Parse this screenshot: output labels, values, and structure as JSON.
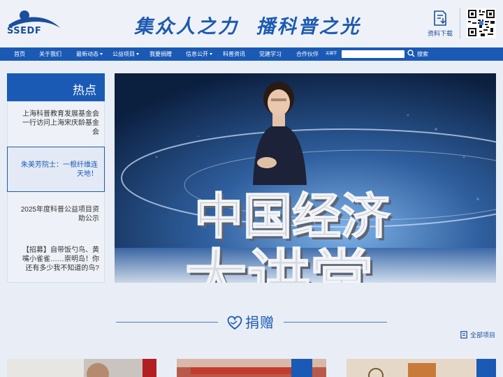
{
  "header": {
    "logo_text": "SSEDF",
    "slogan": "集众人之力  播科普之光",
    "download_label": "资料下载"
  },
  "nav": {
    "items": [
      "首页",
      "关于我们",
      "最新动态",
      "公益项目",
      "我要捐赠",
      "信息公开",
      "科普资讯",
      "党建学习",
      "合作伙伴"
    ],
    "keyword_label": "关键字",
    "search_placeholder": "",
    "search_label": "搜索"
  },
  "hot": {
    "title": "热点",
    "items": [
      "上海科普教育发展基金会一行访问上海宋庆龄基金会",
      "朱美芳院士：一根纤维连天地！",
      "2025年度科普公益项目资助公示",
      "【招募】自带饭勺鸟、黄嘴小雀雀……崇明岛！你还有多少我不知道的鸟?"
    ]
  },
  "banner": {
    "stage_text_top": "中国经济",
    "stage_text_bottom": "大讲堂"
  },
  "donation": {
    "title": "捐赠",
    "all_projects": "全部项目"
  },
  "colors": {
    "primary": "#1a5ab5",
    "background": "#e9eef6"
  }
}
